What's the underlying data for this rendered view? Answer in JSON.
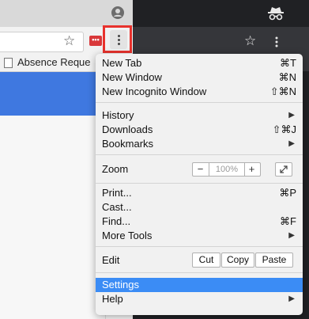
{
  "bookmarks_bar": {
    "item": "Absence Reque"
  },
  "extension_badge": "•••",
  "icons": {
    "star": "☆",
    "profile": "profile-icon",
    "incognito": "incognito-icon",
    "submenu": "▶"
  },
  "colors": {
    "highlight": "#e8322d",
    "selected": "#3b8cf5",
    "page_header": "#3f78e0"
  },
  "menu": {
    "new_tab": {
      "label": "New Tab",
      "shortcut": "⌘T"
    },
    "new_window": {
      "label": "New Window",
      "shortcut": "⌘N"
    },
    "new_incognito": {
      "label": "New Incognito Window",
      "shortcut": "⇧⌘N"
    },
    "history": {
      "label": "History"
    },
    "downloads": {
      "label": "Downloads",
      "shortcut": "⇧⌘J"
    },
    "bookmarks": {
      "label": "Bookmarks"
    },
    "zoom": {
      "label": "Zoom",
      "minus": "−",
      "value": "100%",
      "plus": "+"
    },
    "print": {
      "label": "Print...",
      "shortcut": "⌘P"
    },
    "cast": {
      "label": "Cast..."
    },
    "find": {
      "label": "Find...",
      "shortcut": "⌘F"
    },
    "more_tools": {
      "label": "More Tools"
    },
    "edit": {
      "label": "Edit",
      "cut": "Cut",
      "copy": "Copy",
      "paste": "Paste"
    },
    "settings": {
      "label": "Settings"
    },
    "help": {
      "label": "Help"
    }
  }
}
